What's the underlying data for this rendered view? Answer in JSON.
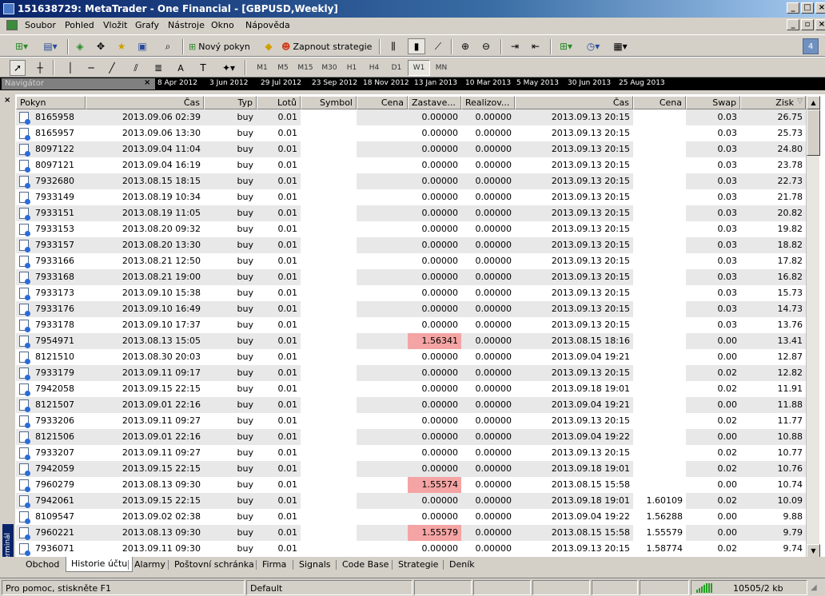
{
  "window": {
    "title": "151638729: MetaTrader - One Financial - [GBPUSD,Weekly]"
  },
  "menu": [
    "Soubor",
    "Pohled",
    "Vložit",
    "Grafy",
    "Nástroje",
    "Okno",
    "Nápověda"
  ],
  "toolbar": {
    "new_order": "Nový pokyn",
    "start_strategy": "Zapnout strategie",
    "text_tool": "A",
    "badge": "4"
  },
  "timeframes": [
    "M1",
    "M5",
    "M15",
    "M30",
    "H1",
    "H4",
    "D1",
    "W1",
    "MN"
  ],
  "active_timeframe": "W1",
  "navigator": {
    "title": "Navigátor",
    "close": "×"
  },
  "timescale": [
    "8 Apr 2012",
    "3 Jun 2012",
    "29 Jul 2012",
    "23 Sep 2012",
    "18 Nov 2012",
    "13 Jan 2013",
    "10 Mar 2013",
    "5 May 2013",
    "30 Jun 2013",
    "25 Aug 2013"
  ],
  "terminal": {
    "side_label": "Terminál",
    "close": "×"
  },
  "table": {
    "columns": [
      "Pokyn",
      "Čas",
      "Typ",
      "Lotů",
      "Symbol",
      "Cena",
      "Zastave...",
      "Realizov...",
      "Čas",
      "Cena",
      "Swap",
      "Zisk"
    ],
    "sort_indicator": "▽",
    "rows": [
      {
        "order": "8165958",
        "open_time": "2013.09.06 02:39",
        "type": "buy",
        "lots": "0.01",
        "sl": "0.00000",
        "tp": "0.00000",
        "close_time": "2013.09.13 20:15",
        "close_price": "",
        "swap": "0.03",
        "profit": "26.75",
        "sl_hit": false
      },
      {
        "order": "8165957",
        "open_time": "2013.09.06 13:30",
        "type": "buy",
        "lots": "0.01",
        "sl": "0.00000",
        "tp": "0.00000",
        "close_time": "2013.09.13 20:15",
        "close_price": "",
        "swap": "0.03",
        "profit": "25.73",
        "sl_hit": false
      },
      {
        "order": "8097122",
        "open_time": "2013.09.04 11:04",
        "type": "buy",
        "lots": "0.01",
        "sl": "0.00000",
        "tp": "0.00000",
        "close_time": "2013.09.13 20:15",
        "close_price": "",
        "swap": "0.03",
        "profit": "24.80",
        "sl_hit": false
      },
      {
        "order": "8097121",
        "open_time": "2013.09.04 16:19",
        "type": "buy",
        "lots": "0.01",
        "sl": "0.00000",
        "tp": "0.00000",
        "close_time": "2013.09.13 20:15",
        "close_price": "",
        "swap": "0.03",
        "profit": "23.78",
        "sl_hit": false
      },
      {
        "order": "7932680",
        "open_time": "2013.08.15 18:15",
        "type": "buy",
        "lots": "0.01",
        "sl": "0.00000",
        "tp": "0.00000",
        "close_time": "2013.09.13 20:15",
        "close_price": "",
        "swap": "0.03",
        "profit": "22.73",
        "sl_hit": false
      },
      {
        "order": "7933149",
        "open_time": "2013.08.19 10:34",
        "type": "buy",
        "lots": "0.01",
        "sl": "0.00000",
        "tp": "0.00000",
        "close_time": "2013.09.13 20:15",
        "close_price": "",
        "swap": "0.03",
        "profit": "21.78",
        "sl_hit": false
      },
      {
        "order": "7933151",
        "open_time": "2013.08.19 11:05",
        "type": "buy",
        "lots": "0.01",
        "sl": "0.00000",
        "tp": "0.00000",
        "close_time": "2013.09.13 20:15",
        "close_price": "",
        "swap": "0.03",
        "profit": "20.82",
        "sl_hit": false
      },
      {
        "order": "7933153",
        "open_time": "2013.08.20 09:32",
        "type": "buy",
        "lots": "0.01",
        "sl": "0.00000",
        "tp": "0.00000",
        "close_time": "2013.09.13 20:15",
        "close_price": "",
        "swap": "0.03",
        "profit": "19.82",
        "sl_hit": false
      },
      {
        "order": "7933157",
        "open_time": "2013.08.20 13:30",
        "type": "buy",
        "lots": "0.01",
        "sl": "0.00000",
        "tp": "0.00000",
        "close_time": "2013.09.13 20:15",
        "close_price": "",
        "swap": "0.03",
        "profit": "18.82",
        "sl_hit": false
      },
      {
        "order": "7933166",
        "open_time": "2013.08.21 12:50",
        "type": "buy",
        "lots": "0.01",
        "sl": "0.00000",
        "tp": "0.00000",
        "close_time": "2013.09.13 20:15",
        "close_price": "",
        "swap": "0.03",
        "profit": "17.82",
        "sl_hit": false
      },
      {
        "order": "7933168",
        "open_time": "2013.08.21 19:00",
        "type": "buy",
        "lots": "0.01",
        "sl": "0.00000",
        "tp": "0.00000",
        "close_time": "2013.09.13 20:15",
        "close_price": "",
        "swap": "0.03",
        "profit": "16.82",
        "sl_hit": false
      },
      {
        "order": "7933173",
        "open_time": "2013.09.10 15:38",
        "type": "buy",
        "lots": "0.01",
        "sl": "0.00000",
        "tp": "0.00000",
        "close_time": "2013.09.13 20:15",
        "close_price": "",
        "swap": "0.03",
        "profit": "15.73",
        "sl_hit": false
      },
      {
        "order": "7933176",
        "open_time": "2013.09.10 16:49",
        "type": "buy",
        "lots": "0.01",
        "sl": "0.00000",
        "tp": "0.00000",
        "close_time": "2013.09.13 20:15",
        "close_price": "",
        "swap": "0.03",
        "profit": "14.73",
        "sl_hit": false
      },
      {
        "order": "7933178",
        "open_time": "2013.09.10 17:37",
        "type": "buy",
        "lots": "0.01",
        "sl": "0.00000",
        "tp": "0.00000",
        "close_time": "2013.09.13 20:15",
        "close_price": "",
        "swap": "0.03",
        "profit": "13.76",
        "sl_hit": false
      },
      {
        "order": "7954971",
        "open_time": "2013.08.13 15:05",
        "type": "buy",
        "lots": "0.01",
        "sl": "1.56341",
        "tp": "0.00000",
        "close_time": "2013.08.15 18:16",
        "close_price": "",
        "swap": "0.00",
        "profit": "13.41",
        "sl_hit": true
      },
      {
        "order": "8121510",
        "open_time": "2013.08.30 20:03",
        "type": "buy",
        "lots": "0.01",
        "sl": "0.00000",
        "tp": "0.00000",
        "close_time": "2013.09.04 19:21",
        "close_price": "",
        "swap": "0.00",
        "profit": "12.87",
        "sl_hit": false
      },
      {
        "order": "7933179",
        "open_time": "2013.09.11 09:17",
        "type": "buy",
        "lots": "0.01",
        "sl": "0.00000",
        "tp": "0.00000",
        "close_time": "2013.09.13 20:15",
        "close_price": "",
        "swap": "0.02",
        "profit": "12.82",
        "sl_hit": false
      },
      {
        "order": "7942058",
        "open_time": "2013.09.15 22:15",
        "type": "buy",
        "lots": "0.01",
        "sl": "0.00000",
        "tp": "0.00000",
        "close_time": "2013.09.18 19:01",
        "close_price": "",
        "swap": "0.02",
        "profit": "11.91",
        "sl_hit": false
      },
      {
        "order": "8121507",
        "open_time": "2013.09.01 22:16",
        "type": "buy",
        "lots": "0.01",
        "sl": "0.00000",
        "tp": "0.00000",
        "close_time": "2013.09.04 19:21",
        "close_price": "",
        "swap": "0.00",
        "profit": "11.88",
        "sl_hit": false
      },
      {
        "order": "7933206",
        "open_time": "2013.09.11 09:27",
        "type": "buy",
        "lots": "0.01",
        "sl": "0.00000",
        "tp": "0.00000",
        "close_time": "2013.09.13 20:15",
        "close_price": "",
        "swap": "0.02",
        "profit": "11.77",
        "sl_hit": false
      },
      {
        "order": "8121506",
        "open_time": "2013.09.01 22:16",
        "type": "buy",
        "lots": "0.01",
        "sl": "0.00000",
        "tp": "0.00000",
        "close_time": "2013.09.04 19:22",
        "close_price": "",
        "swap": "0.00",
        "profit": "10.88",
        "sl_hit": false
      },
      {
        "order": "7933207",
        "open_time": "2013.09.11 09:27",
        "type": "buy",
        "lots": "0.01",
        "sl": "0.00000",
        "tp": "0.00000",
        "close_time": "2013.09.13 20:15",
        "close_price": "",
        "swap": "0.02",
        "profit": "10.77",
        "sl_hit": false
      },
      {
        "order": "7942059",
        "open_time": "2013.09.15 22:15",
        "type": "buy",
        "lots": "0.01",
        "sl": "0.00000",
        "tp": "0.00000",
        "close_time": "2013.09.18 19:01",
        "close_price": "",
        "swap": "0.02",
        "profit": "10.76",
        "sl_hit": false
      },
      {
        "order": "7960279",
        "open_time": "2013.08.13 09:30",
        "type": "buy",
        "lots": "0.01",
        "sl": "1.55574",
        "tp": "0.00000",
        "close_time": "2013.08.15 15:58",
        "close_price": "",
        "swap": "0.00",
        "profit": "10.74",
        "sl_hit": true
      },
      {
        "order": "7942061",
        "open_time": "2013.09.15 22:15",
        "type": "buy",
        "lots": "0.01",
        "sl": "0.00000",
        "tp": "0.00000",
        "close_time": "2013.09.18 19:01",
        "close_price": "1.60109",
        "swap": "0.02",
        "profit": "10.09",
        "sl_hit": false
      },
      {
        "order": "8109547",
        "open_time": "2013.09.02 02:38",
        "type": "buy",
        "lots": "0.01",
        "sl": "0.00000",
        "tp": "0.00000",
        "close_time": "2013.09.04 19:22",
        "close_price": "1.56288",
        "swap": "0.00",
        "profit": "9.88",
        "sl_hit": false
      },
      {
        "order": "7960221",
        "open_time": "2013.08.13 09:30",
        "type": "buy",
        "lots": "0.01",
        "sl": "1.55579",
        "tp": "0.00000",
        "close_time": "2013.08.15 15:58",
        "close_price": "1.55579",
        "swap": "0.00",
        "profit": "9.79",
        "sl_hit": true
      },
      {
        "order": "7936071",
        "open_time": "2013.09.11 09:30",
        "type": "buy",
        "lots": "0.01",
        "sl": "0.00000",
        "tp": "0.00000",
        "close_time": "2013.09.13 20:15",
        "close_price": "1.58774",
        "swap": "0.02",
        "profit": "9.74",
        "sl_hit": false
      }
    ]
  },
  "tabs": [
    "Obchod",
    "Historie účtu",
    "Alarmy",
    "Poštovní schránka",
    "Firma",
    "Signals",
    "Code Base",
    "Strategie",
    "Deník"
  ],
  "active_tab": "Historie účtu",
  "status": {
    "help": "Pro pomoc, stiskněte F1",
    "profile": "Default",
    "traffic": "10505/2 kb"
  },
  "colors": {
    "sl_highlight": "#f4a4a4",
    "title_bar": "#0a246a",
    "row_alt": "#e8e8e8"
  }
}
